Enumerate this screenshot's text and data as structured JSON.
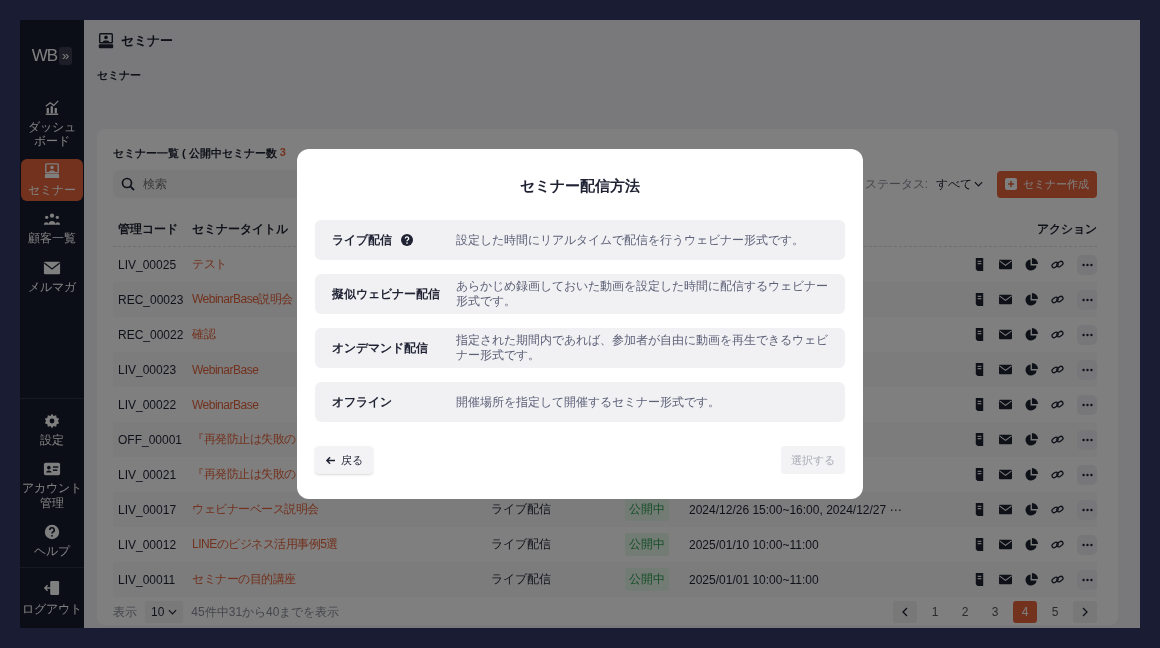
{
  "sidebar": {
    "logo": "WB",
    "expand_button": "»",
    "items": [
      {
        "label": [
          "ダッシュ",
          "ボード"
        ],
        "selected": false
      },
      {
        "label": [
          "セミナー"
        ],
        "selected": true
      },
      {
        "label": [
          "顧客一覧"
        ],
        "selected": false
      },
      {
        "label": [
          "メルマガ"
        ],
        "selected": false
      }
    ],
    "bottom_items": [
      {
        "label": [
          "設定"
        ]
      },
      {
        "label": [
          "アカウント",
          "管理"
        ]
      },
      {
        "label": [
          "ヘルプ"
        ]
      }
    ],
    "logout": "ログアウト"
  },
  "page_header": {
    "title": "セミナー",
    "breadcrumb": "セミナー"
  },
  "card": {
    "title": "セミナー一覧 ( 公開中セミナー数",
    "count": "3",
    "search": {
      "placeholder": "検索"
    },
    "status_filter": {
      "label": "ステータス:",
      "value": "すべて"
    },
    "create_button": "セミナー作成"
  },
  "table": {
    "columns": {
      "code": "管理コード",
      "title": "セミナータイトル",
      "actions": "アクション"
    },
    "rows": [
      {
        "code": "LIV_00025",
        "title": "テスト"
      },
      {
        "code": "REC_00023",
        "title": "WebinarBase説明会"
      },
      {
        "code": "REC_00022",
        "title": "確認"
      },
      {
        "code": "LIV_00023",
        "title": "WebinarBase"
      },
      {
        "code": "LIV_00022",
        "title": "WebinarBase"
      },
      {
        "code": "OFF_00001",
        "title": "『再発防止は失敗の"
      },
      {
        "code": "LIV_00021",
        "title": "『再発防止は失敗の"
      },
      {
        "code": "LIV_00017",
        "title": "ウェビナーベース説明会",
        "type": "ライブ配信",
        "status": "公開中",
        "date": "2024/12/26 15:00~16:00, 2024/12/27 ⋯"
      },
      {
        "code": "LIV_00012",
        "title": "LINEのビジネス活用事例5選",
        "type": "ライブ配信",
        "status": "公開中",
        "date": "2025/01/10 10:00~11:00"
      },
      {
        "code": "LIV_00011",
        "title": "セミナーの目的講座",
        "type": "ライブ配信",
        "status": "公開中",
        "date": "2025/01/01 10:00~11:00"
      }
    ]
  },
  "footer": {
    "show_label": "表示",
    "page_size": "10",
    "summary": "45件中31から40までを表示",
    "pages": [
      {
        "label": "1",
        "selected": false
      },
      {
        "label": "2",
        "selected": false
      },
      {
        "label": "3",
        "selected": false
      },
      {
        "label": "4",
        "selected": true
      },
      {
        "label": "5",
        "selected": false
      }
    ]
  },
  "modal": {
    "title": "セミナー配信方法",
    "options": [
      {
        "label": "ライブ配信",
        "help": true,
        "selected": false,
        "description": "設定した時間にリアルタイムで配信を行うウェビナー形式です。"
      },
      {
        "label": "擬似ウェビナー配信",
        "help": false,
        "selected": false,
        "description": "あらかじめ録画しておいた動画を設定した時間に配信するウェビナー形式です。"
      },
      {
        "label": "オンデマンド配信",
        "help": false,
        "selected": false,
        "description": "指定された期間内であれば、参加者が自由に動画を再生できるウェビナー形式です。"
      },
      {
        "label": "オフライン",
        "help": false,
        "selected": false,
        "description": "開催場所を指定して開催するセミナー形式です。"
      }
    ],
    "back_button": "戻る",
    "select_button": {
      "label": "選択する",
      "disabled": true
    }
  }
}
